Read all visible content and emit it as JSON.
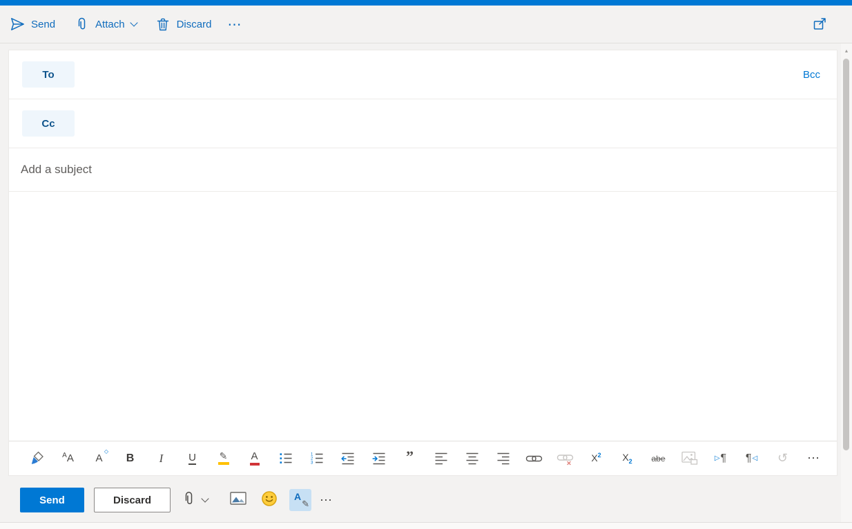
{
  "topbar": {
    "send_label": "Send",
    "attach_label": "Attach",
    "discard_label": "Discard",
    "more_glyph": "⋯"
  },
  "recipients": {
    "to_label": "To",
    "cc_label": "Cc",
    "bcc_label": "Bcc"
  },
  "subject_placeholder": "Add a subject",
  "fmt": {
    "font_small": "A",
    "font_large": "A",
    "fontsize_letter": "A",
    "fontsize_mark": "◇",
    "bold": "B",
    "italic": "I",
    "underline": "U",
    "highlight_pen": "✎",
    "fontcolor_letter": "A",
    "num1": "1",
    "num2": "2",
    "num3": "3",
    "quote": "”",
    "sup_base": "X",
    "sup_exp": "2",
    "sub_base": "X",
    "sub_exp": "2",
    "strike": "abe",
    "ltr_arrow": "▷",
    "ltr_pilcrow": "¶",
    "rtl_pilcrow": "¶",
    "rtl_arrow": "◁",
    "undo_glyph": "↺",
    "more_glyph": "⋯"
  },
  "bottombar": {
    "send_label": "Send",
    "discard_label": "Discard",
    "pen_letter": "A",
    "pen_pencil": "✎",
    "more_glyph": "⋯"
  },
  "scrollbar": {
    "up_arrow": "▲"
  },
  "colors": {
    "accent": "#0078d4",
    "topbar_link": "#0f6cbd",
    "chip_bg": "#eff6fc",
    "chip_text": "#0f548c",
    "highlight_yellow": "#ffc000",
    "fontcolor_red": "#d13438",
    "disabled_icon": "#c8c6c4"
  }
}
